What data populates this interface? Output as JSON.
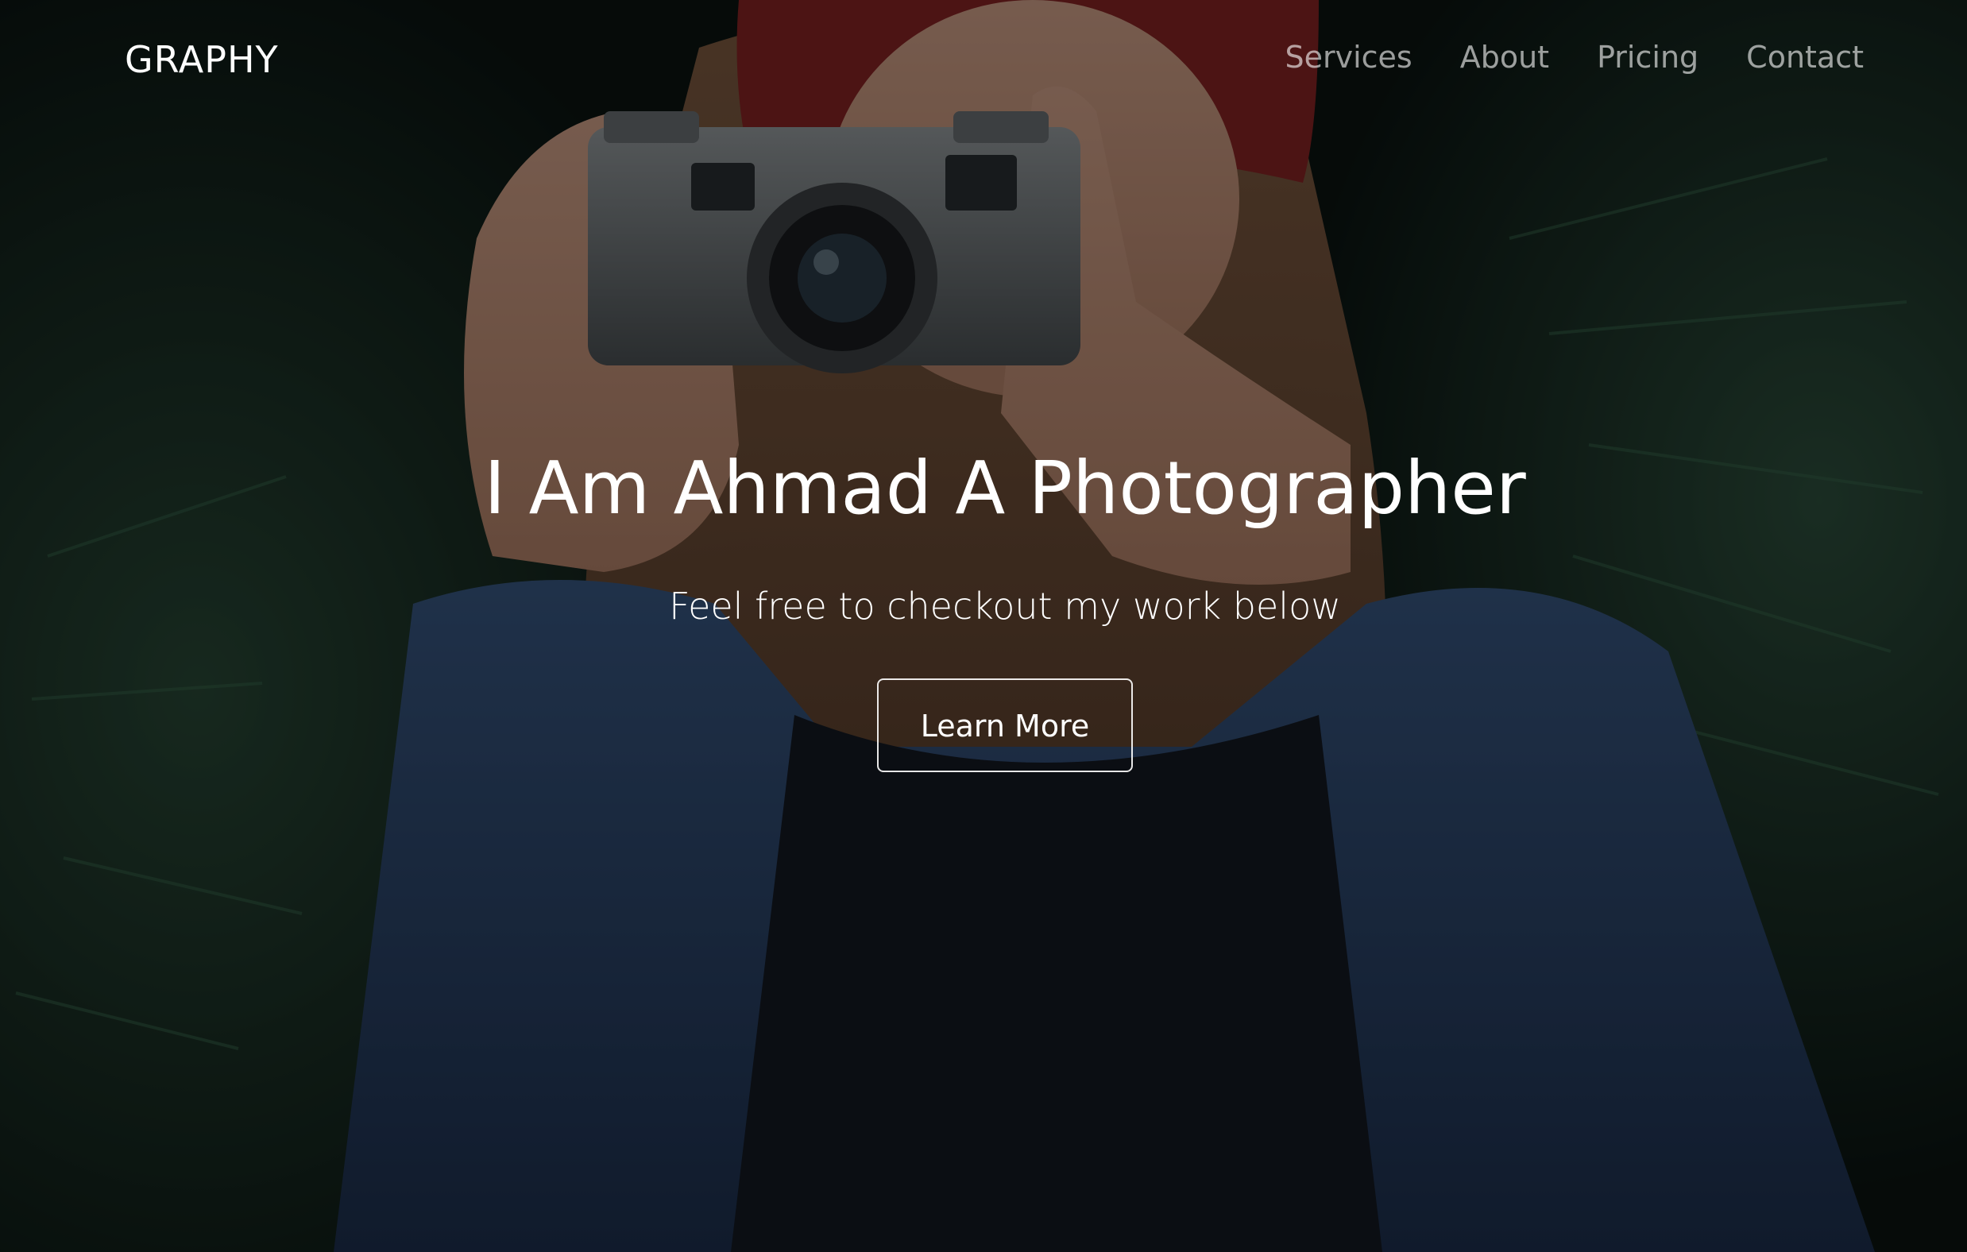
{
  "navbar": {
    "brand": "GRAPHY",
    "links": [
      {
        "label": "Services"
      },
      {
        "label": "About"
      },
      {
        "label": "Pricing"
      },
      {
        "label": "Contact"
      }
    ]
  },
  "hero": {
    "title": "I Am Ahmad A Photographer",
    "subtitle": "Feel free to checkout my work below",
    "cta_label": "Learn More"
  },
  "colors": {
    "text": "#ffffff",
    "nav_text_muted": "#9a9a9a",
    "overlay": "#000000",
    "foliage": "#1e3a2c",
    "denim": "#22375a",
    "beanie": "#7a1e1e",
    "hair": "#6b4a35"
  }
}
